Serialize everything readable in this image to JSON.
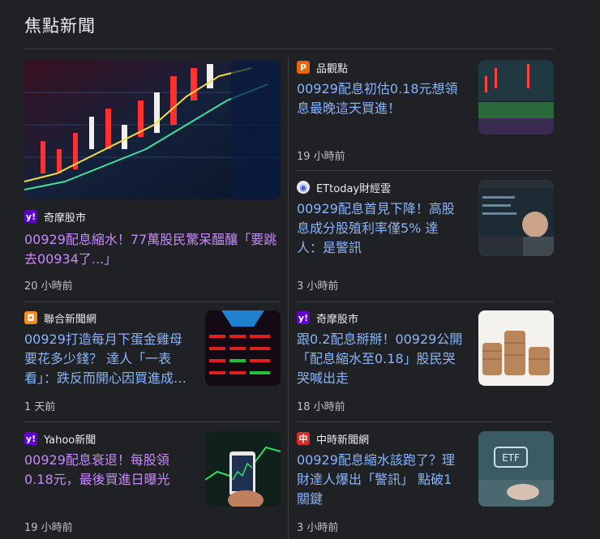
{
  "section": {
    "title": "焦點新聞"
  },
  "colors": {
    "visited": "#c58af9",
    "unvisited": "#8ab4f8",
    "background": "#202124"
  },
  "stories": [
    {
      "source": "奇摩股市",
      "source_icon": "yahoo-icon",
      "headline_line1": "00929配息縮水！77萬股民驚呆醞釀「要跳",
      "headline_line2": "去00934了...」",
      "time": "20 小時前",
      "visited": true
    },
    {
      "source": "品觀點",
      "source_icon": "pinview-icon",
      "headline_line1": "00929配息初估0.18元想領",
      "headline_line2": "息最晚這天買進！",
      "time": "19 小時前",
      "visited": false
    },
    {
      "source": "ETtoday財經雲",
      "source_icon": "ettoday-icon",
      "headline_line1": "00929配息首見下降！高股",
      "headline_line2": "息成分股殖利率僅5% 達",
      "headline_line3": "人：是警訊",
      "time": "3 小時前",
      "visited": false
    },
    {
      "source": "聯合新聞網",
      "source_icon": "udn-icon",
      "headline_line1": "00929打造每月下蛋金雞母",
      "headline_line2": "要花多少錢？ 達人「一表",
      "headline_line3": "看」：跌反而開心因買進成…",
      "time": "1 天前",
      "visited": false
    },
    {
      "source": "奇摩股市",
      "source_icon": "yahoo-icon",
      "headline_line1": "跟0.2配息掰掰！00929公開",
      "headline_line2": "「配息縮水至0.18」股民哭",
      "headline_line3": "哭喊出走",
      "time": "18 小時前",
      "visited": false
    },
    {
      "source": "Yahoo新聞",
      "source_icon": "yahoo-icon",
      "headline_line1": "00929配息衰退！每股領",
      "headline_line2": "0.18元，最後買進日曝光",
      "time": "19 小時前",
      "visited": true
    },
    {
      "source": "中時新聞網",
      "source_icon": "chinatimes-icon",
      "headline_line1": "00929配息縮水該跑了？理",
      "headline_line2": "財達人爆出「警訊」 點破1",
      "headline_line3": "關鍵",
      "time": "3 小時前",
      "visited": false
    }
  ]
}
